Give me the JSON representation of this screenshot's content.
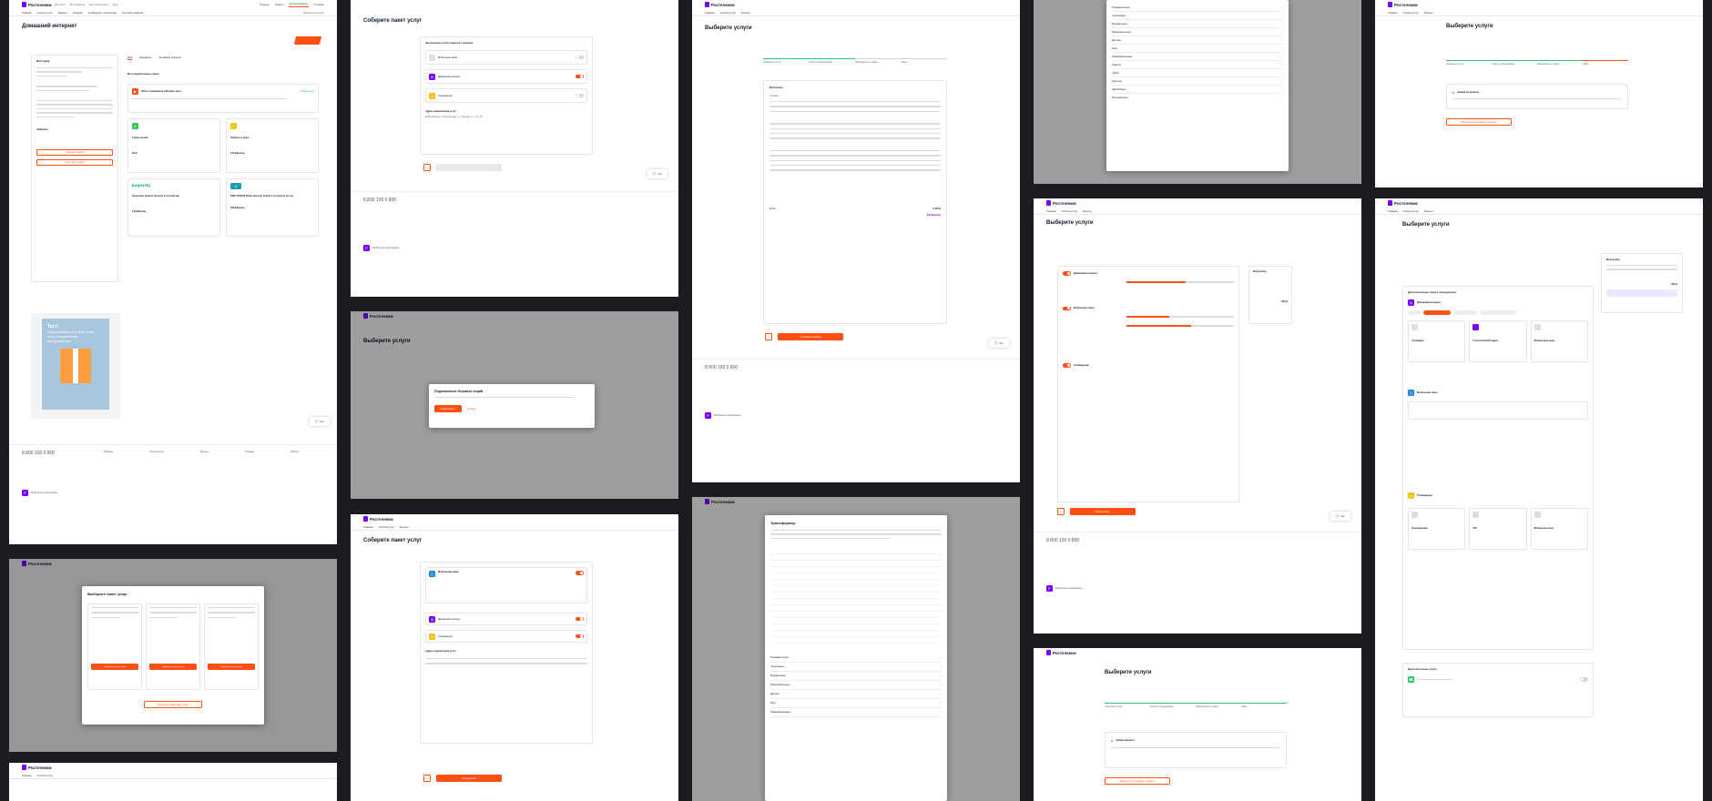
{
  "brand": {
    "name": "Ростелеком",
    "accent": "#ff4f12",
    "purple": "#7700ff",
    "green": "#28c76f"
  },
  "header": {
    "nav": [
      "Для себя",
      "Для бизнеса",
      "Для операторов",
      "Ещё"
    ],
    "right": [
      "Помощь",
      "Офисы",
      "Личный кабинет",
      "Kontaktы"
    ],
    "tabs": [
      "Главная",
      "Оплата услуг",
      "Бонусы",
      "Подарки",
      "Активируйте промокоды",
      "Игровые сервисы"
    ],
    "region": "Выберите регион"
  },
  "frame1": {
    "title": "Домашний интернет",
    "my_tariff": "Мой тариф",
    "sub_tabs": [
      "Моё",
      "Документы",
      "Активация подписок"
    ],
    "options_title": "Мои подключённые опции",
    "packet_title": "Пакет телеканалов «Лёгкий старт»",
    "packet_status": "Подключено",
    "turbo": "Турбо-кнопка",
    "child": "Ребёнок в доме",
    "price1": "90 ₽",
    "price2": "100 ₽/месяц",
    "kaspersky_brand": "kaspersky",
    "kaspersky_title": "Kaspersky Internet Security 2 устройства",
    "kaspersky_price": "149 ₽/месяц",
    "eset_title": "ESET NOD32 Smart Security Family 5 устройств на год",
    "eset_price": "180 ₽/месяц",
    "change_btn": "Сменить тариф",
    "more_btn": "Хочу такой тариф",
    "ad_lines": [
      "Тест!",
      "Персонально для Вас у нас",
      "есть специальное",
      "предложение!"
    ],
    "limit": "0 ₽/месяц"
  },
  "frame2": {
    "title": "Соберите пакет услуг",
    "subtitle": "Настроенные услуги пакетного решения",
    "items": [
      "Мобильная связь",
      "Домашний интернет",
      "Телевидение"
    ],
    "address_title": "Адрес подключения услуг",
    "address": "Калининград, г Калининград, ул. Горная, д. 1, кв. 15"
  },
  "frame3": {
    "title": "Выберите услуги",
    "steps": [
      "Основные услуги",
      "Опции и оборудование",
      "Информация о заявке",
      "Заказ"
    ],
    "choice_title": "Мой выбор",
    "rate_label": "Тарифы",
    "total_label": "Итого",
    "total_old": "1 500 ₽",
    "total": "400 ₽/месяц",
    "submit": "Отправить заявку"
  },
  "frame4_list": [
    "Познавательное",
    "Спортивные",
    "Музыкальные",
    "Развлекательные",
    "Детские",
    "Кино",
    "Информационные",
    "Новости",
    "Хобби",
    "Культура",
    "Зарубежные",
    "Региональные"
  ],
  "frame5": {
    "title": "Выберите услуги",
    "error_title": "Заявка не принята",
    "back_btn": "Вернуться на главную страницу"
  },
  "modal_games": {
    "title": "Подключение Игровых опций",
    "ok": "Подключить",
    "cancel": "Отмена"
  },
  "modal_packs": {
    "title": "Выберите пакет услуг",
    "btn": "Подключить пакет услуг",
    "custom": "Настроить свой пакет услуг"
  },
  "transformer": {
    "title": "Трансформер",
    "rows": [
      "Познавательное",
      "Спортивные",
      "Музыкальные",
      "Развлекательные",
      "Детские",
      "Кино",
      "Информационные"
    ]
  },
  "accepted": {
    "title": "Выберите услуги",
    "msg": "Заявка принята",
    "btn": "Вернуться на главную страницу"
  },
  "right_big": {
    "title": "Выберите услуги",
    "section": "Дополнительные опции и оборудование",
    "choice": "Мой выбор",
    "sum": "600 ₽",
    "mobile": "Мобильная связь",
    "tv": "Телевидение",
    "extra": "Дополнительные услуги",
    "tiles": [
      "Антивирус",
      "Статический IP-адрес",
      "Мобильные игры"
    ],
    "tv_tiles": [
      "Трансформер",
      "VIP",
      "Мобильное кино"
    ]
  },
  "frame_mid": {
    "title": "Выберите услуги",
    "services": [
      "Домашний интернет",
      "Мобильная связь",
      "Телевидение"
    ],
    "sum": "600 ₽",
    "btn": "Продолжить"
  },
  "footer": {
    "phone": "8 800 100 0 800",
    "cols": [
      "Помощь",
      "Оплата услуг",
      "Бонусы",
      "Тарифы",
      "Офисы"
    ],
    "app": "Мобильное приложение",
    "chat": "Чат"
  }
}
